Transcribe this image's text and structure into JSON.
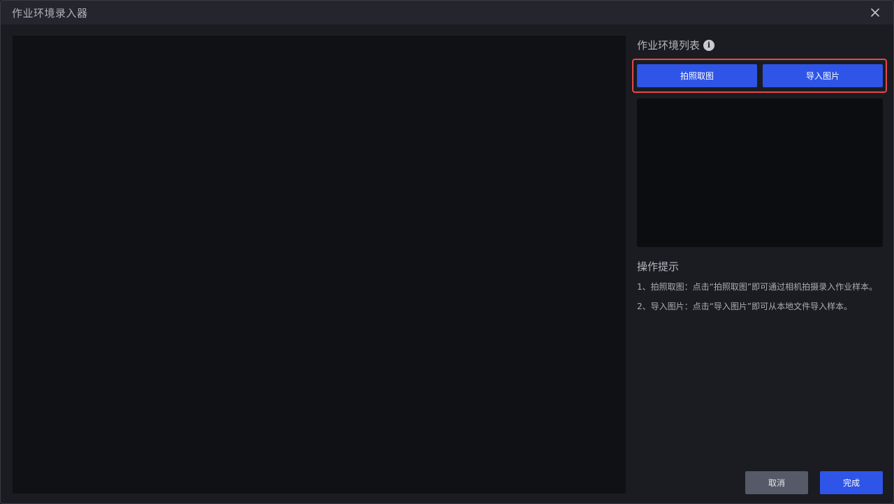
{
  "window": {
    "title": "作业环境录入器"
  },
  "panel": {
    "list_title": "作业环境列表",
    "capture_label": "拍照取图",
    "import_label": "导入图片"
  },
  "hints": {
    "title": "操作提示",
    "items": [
      "1、拍照取图：点击“拍照取图”即可通过相机拍摄录入作业样本。",
      "2、导入图片：点击“导入图片”即可从本地文件导入样本。"
    ]
  },
  "footer": {
    "cancel_label": "取消",
    "done_label": "完成"
  },
  "colors": {
    "primary": "#2e55e8",
    "highlight": "#e8474a",
    "background": "#1b1c21",
    "preview": "#101115"
  },
  "icons": {
    "close": "close-icon",
    "info": "info-icon"
  }
}
